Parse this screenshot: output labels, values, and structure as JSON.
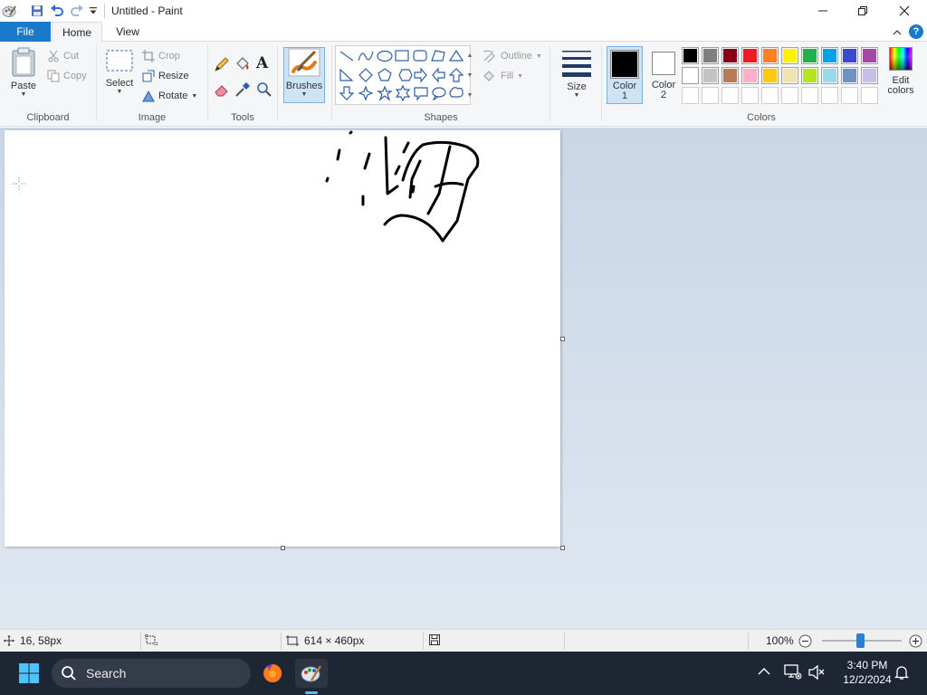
{
  "window": {
    "title": "Untitled - Paint",
    "controls": {
      "minimize": "minimize",
      "maximize": "maximize",
      "close": "close"
    }
  },
  "menu": {
    "tabs": [
      {
        "label": "File"
      },
      {
        "label": "Home"
      },
      {
        "label": "View"
      }
    ],
    "active_tab": "Home"
  },
  "ribbon": {
    "clipboard": {
      "group_label": "Clipboard",
      "paste": "Paste",
      "cut": "Cut",
      "copy": "Copy"
    },
    "image": {
      "group_label": "Image",
      "select": "Select",
      "crop": "Crop",
      "resize": "Resize",
      "rotate": "Rotate"
    },
    "tools": {
      "group_label": "Tools",
      "icons": [
        "pencil-icon",
        "fill-icon",
        "text-icon",
        "eraser-icon",
        "color-picker-icon",
        "magnifier-icon"
      ]
    },
    "brushes": {
      "label": "Brushes"
    },
    "shapes": {
      "group_label": "Shapes",
      "outline": "Outline",
      "fill": "Fill"
    },
    "size": {
      "label": "Size"
    },
    "colors": {
      "group_label": "Colors",
      "color1": {
        "label_line1": "Color",
        "label_line2": "1",
        "value": "#000000"
      },
      "color2": {
        "label_line1": "Color",
        "label_line2": "2",
        "value": "#ffffff"
      },
      "edit_colors_line1": "Edit",
      "edit_colors_line2": "colors",
      "palette_row1": [
        "#000000",
        "#7f7f7f",
        "#880015",
        "#ed1c24",
        "#ff7f27",
        "#fff200",
        "#22b14c",
        "#00a2e8",
        "#3f48cc",
        "#a349a4"
      ],
      "palette_row2": [
        "#ffffff",
        "#c3c3c3",
        "#b97a57",
        "#ffaec9",
        "#ffc90e",
        "#efe4b0",
        "#b5e61d",
        "#99d9ea",
        "#7092be",
        "#c8bfe7"
      ],
      "palette_row3": [
        "",
        "",
        "",
        "",
        "",
        "",
        "",
        "",
        "",
        ""
      ]
    }
  },
  "status": {
    "cursor_position": "16, 58px",
    "selection_size": "",
    "canvas_size": "614 × 460px",
    "zoom": "100%"
  },
  "taskbar": {
    "search_placeholder": "Search",
    "time": "3:40 PM",
    "date": "12/2/2024"
  },
  "colors": {
    "accent": "#1979ca",
    "taskbar_bg": "#1f2633"
  }
}
